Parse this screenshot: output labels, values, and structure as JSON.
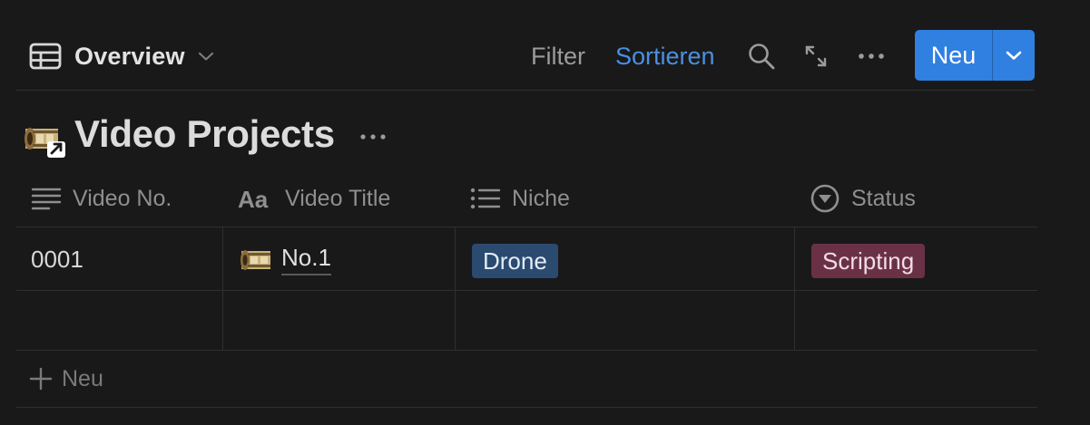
{
  "toolbar": {
    "view_label": "Overview",
    "filter_label": "Filter",
    "sort_label": "Sortieren",
    "new_label": "Neu",
    "accent_color": "#2f80e0",
    "sort_color": "#4a90e2"
  },
  "database": {
    "title": "Video Projects",
    "icon": "film-roll-icon"
  },
  "table": {
    "columns": [
      {
        "label": "Video No.",
        "icon": "text-lines-icon"
      },
      {
        "label": "Video Title",
        "icon": "title-aa-icon"
      },
      {
        "label": "Niche",
        "icon": "list-icon"
      },
      {
        "label": "Status",
        "icon": "status-circle-icon"
      }
    ],
    "rows": [
      {
        "video_no": "0001",
        "video_title": "No.1",
        "niche": {
          "label": "Drone",
          "color": "#2b4a70"
        },
        "status": {
          "label": "Scripting",
          "color": "#6a3146"
        }
      }
    ]
  },
  "add_row_label": "Neu"
}
